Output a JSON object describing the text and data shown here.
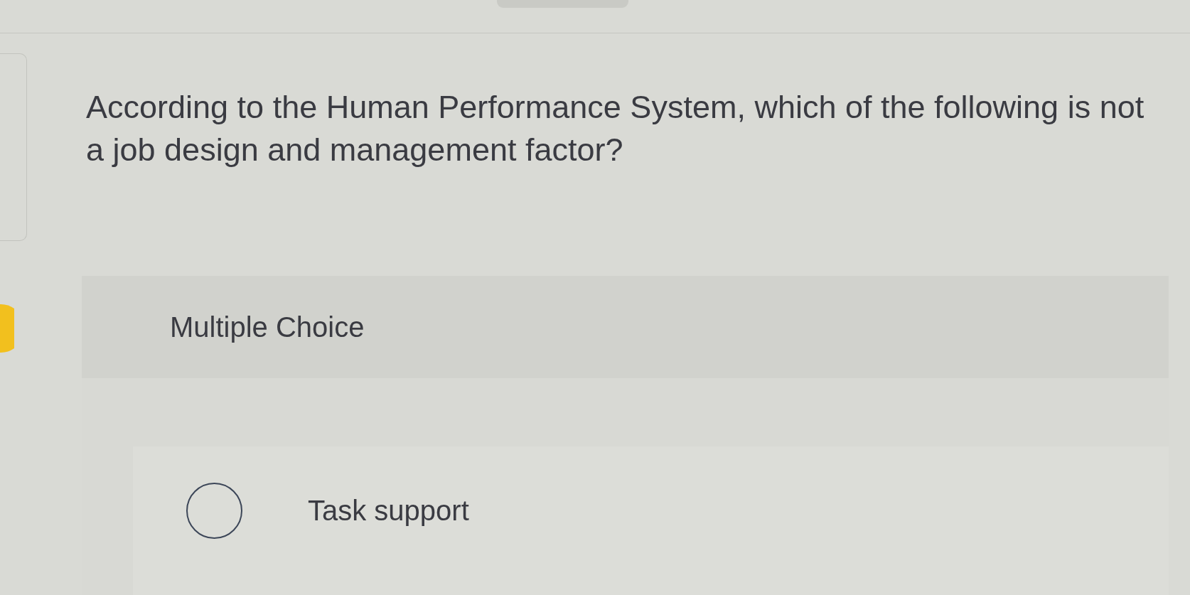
{
  "question": {
    "text": "According to the Human Performance System, which of the following is not a job design and management factor?"
  },
  "question_type": {
    "label": "Multiple Choice"
  },
  "choices": [
    {
      "label": "Task support",
      "selected": false
    }
  ]
}
